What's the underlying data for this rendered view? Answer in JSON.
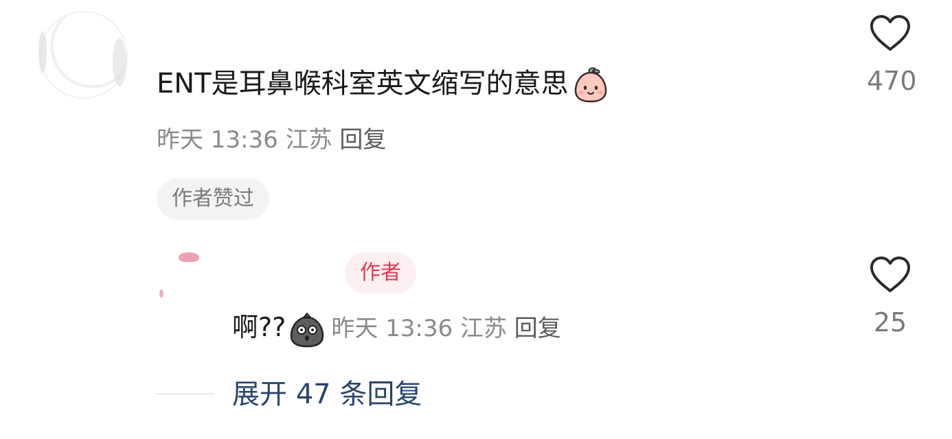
{
  "comment": {
    "text": "ENT是耳鼻喉科室英文缩写的意思",
    "emoji": "peach-smile-icon",
    "time": "昨天 13:36",
    "location": "江苏",
    "reply_label": "回复",
    "author_liked_badge": "作者赞过",
    "like_count": "470"
  },
  "reply": {
    "author_tag": "作者",
    "text": "啊??",
    "emoji": "shocked-bag-icon",
    "time": "昨天 13:36",
    "location": "江苏",
    "reply_label": "回复",
    "like_count": "25"
  },
  "expand": {
    "label": "展开 47 条回复"
  },
  "colors": {
    "text_primary": "#1a1a1a",
    "text_secondary": "#8a8a8a",
    "link_blue": "#28456f",
    "author_red": "#e03a4e",
    "author_badge_bg": "#fdeff1",
    "pill_bg": "#f3f3f5"
  }
}
